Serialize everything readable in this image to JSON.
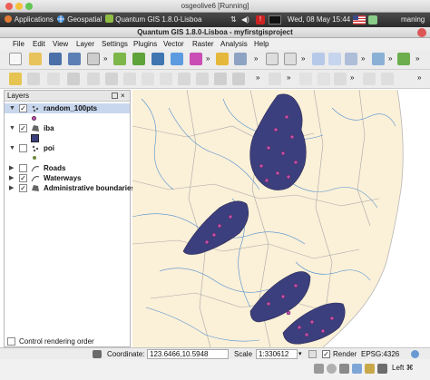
{
  "window_title": "osgeolive6 [Running]",
  "gnome_panel": {
    "applications": "Applications",
    "geospatial": "Geospatial",
    "task": "Quantum GIS 1.8.0-Lisboa",
    "datetime": "Wed, 08 May 15:44",
    "user": "maning"
  },
  "qgis_title": "Quantum GIS 1.8.0-Lisboa - myfirstgisproject",
  "menu": [
    "File",
    "Edit",
    "View",
    "Layer",
    "Settings",
    "Plugins",
    "Vector",
    "Raster",
    "Analysis",
    "Help"
  ],
  "layers_panel": {
    "title": "Layers",
    "layers": [
      {
        "name": "random_100pts",
        "checked": true,
        "expanded": true,
        "icon": "point-layer-icon"
      },
      {
        "name": "iba",
        "checked": true,
        "expanded": true,
        "icon": "polygon-layer-icon"
      },
      {
        "name": "poi",
        "checked": false,
        "expanded": true,
        "icon": "point-layer-icon"
      },
      {
        "name": "Roads",
        "checked": false,
        "expanded": false,
        "icon": "line-layer-icon"
      },
      {
        "name": "Waterways",
        "checked": true,
        "expanded": false,
        "icon": "line-layer-icon"
      },
      {
        "name": "Administrative boundaries",
        "checked": true,
        "expanded": false,
        "icon": "polygon-layer-icon"
      }
    ],
    "control_rendering_order": "Control rendering order"
  },
  "status_bar": {
    "coordinate_label": "Coordinate:",
    "coordinate_value": "123.6466,10.5948",
    "scale_label": "Scale",
    "scale_value": "1:330612",
    "render_label": "Render",
    "epsg": "EPSG:4326"
  },
  "dock": {
    "left_label": "Left ⌘"
  },
  "colors": {
    "land": "#fbf0d8",
    "water": "#4f8fcf",
    "iba_fill": "#3c3f7d",
    "point": "#c552b3",
    "boundary": "#a8a8a8"
  }
}
